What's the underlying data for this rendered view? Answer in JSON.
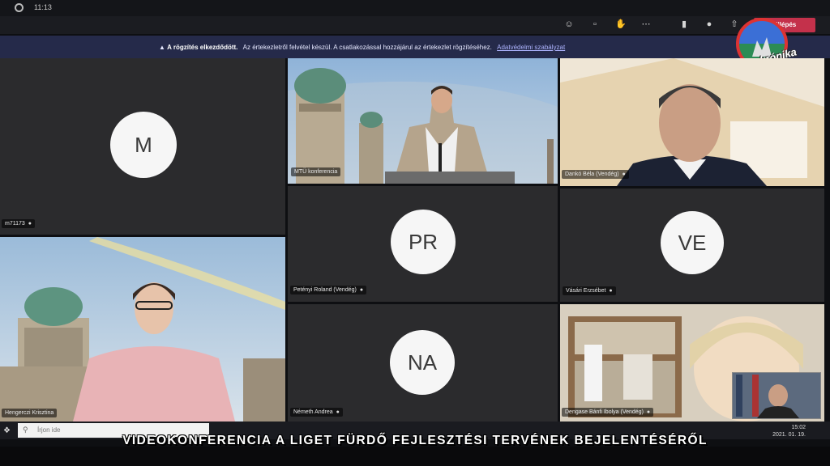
{
  "system": {
    "time": "11:13"
  },
  "toolbar": {
    "leave_label": "Kilépés"
  },
  "banner": {
    "title": "A rögzítés elkezdődött.",
    "message": "Az értekezletről felvétel készül. A csatlakozással hozzájárul az értekezlet rögzítéséhez.",
    "link": "Adatvédelmi szabályzat"
  },
  "tiles": [
    {
      "id": "m",
      "initials": "M",
      "name": "m71173"
    },
    {
      "id": "mto",
      "name": "MTÜ konferencia"
    },
    {
      "id": "danko",
      "name": "Dankó Béla (Vendég)"
    },
    {
      "id": "hegyeczi",
      "name": "Hengerczi Krisztina"
    },
    {
      "id": "pr",
      "initials": "PR",
      "name": "Petényi Roland (Vendég)"
    },
    {
      "id": "ve",
      "initials": "VE",
      "name": "Vásári Erzsébet"
    },
    {
      "id": "na",
      "initials": "NA",
      "name": "Németh Andrea"
    },
    {
      "id": "dengase",
      "name": "Dengase Bánfi Ibolya (Vendég)"
    }
  ],
  "logo": {
    "text": "Videokrónika"
  },
  "taskbar": {
    "search_placeholder": "Írjon ide",
    "clock_time": "15:02",
    "clock_date": "2021. 01. 19."
  },
  "caption": "VIDEOKONFERENCIA A LIGET FÜRDŐ FEJLESZTÉSI TERVÉNEK BEJELENTÉSÉRŐL",
  "colors": {
    "leave": "#c4314b",
    "banner": "#252a4a",
    "tile": "#2b2b2d",
    "avatar": "#f6f6f6"
  }
}
